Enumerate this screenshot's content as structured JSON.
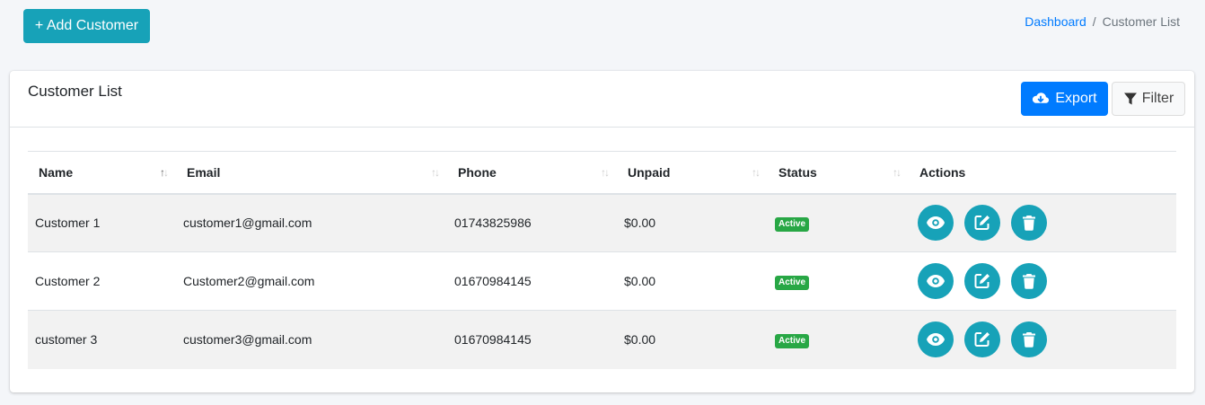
{
  "toolbar": {
    "add_label": "+ Add Customer"
  },
  "breadcrumb": {
    "home": "Dashboard",
    "separator": "/",
    "current": "Customer List"
  },
  "card": {
    "title": "Customer List",
    "export_label": "Export",
    "filter_label": "Filter"
  },
  "table": {
    "columns": [
      "Name",
      "Email",
      "Phone",
      "Unpaid",
      "Status",
      "Actions"
    ],
    "rows": [
      {
        "name": "Customer 1",
        "email": "customer1@gmail.com",
        "phone": "01743825986",
        "unpaid": "$0.00",
        "status": "Active"
      },
      {
        "name": "Customer 2",
        "email": "Customer2@gmail.com",
        "phone": "01670984145",
        "unpaid": "$0.00",
        "status": "Active"
      },
      {
        "name": "customer 3",
        "email": "customer3@gmail.com",
        "phone": "01670984145",
        "unpaid": "$0.00",
        "status": "Active"
      }
    ]
  },
  "icons": {
    "export": "cloud-download-icon",
    "filter": "funnel-icon",
    "view": "eye-icon",
    "edit": "edit-icon",
    "delete": "trash-icon",
    "sort": "sort-arrows-icon"
  },
  "colors": {
    "info": "#17a2b8",
    "primary": "#007bff",
    "success": "#28a745"
  }
}
